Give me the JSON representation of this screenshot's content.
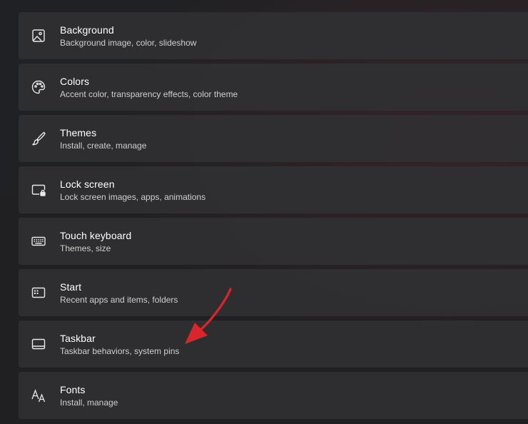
{
  "settings": {
    "items": [
      {
        "icon": "image-icon",
        "title": "Background",
        "subtitle": "Background image, color, slideshow"
      },
      {
        "icon": "palette-icon",
        "title": "Colors",
        "subtitle": "Accent color, transparency effects, color theme"
      },
      {
        "icon": "brush-icon",
        "title": "Themes",
        "subtitle": "Install, create, manage"
      },
      {
        "icon": "lock-screen-icon",
        "title": "Lock screen",
        "subtitle": "Lock screen images, apps, animations"
      },
      {
        "icon": "keyboard-icon",
        "title": "Touch keyboard",
        "subtitle": "Themes, size"
      },
      {
        "icon": "start-menu-icon",
        "title": "Start",
        "subtitle": "Recent apps and items, folders"
      },
      {
        "icon": "taskbar-icon",
        "title": "Taskbar",
        "subtitle": "Taskbar behaviors, system pins"
      },
      {
        "icon": "fonts-icon",
        "title": "Fonts",
        "subtitle": "Install, manage"
      }
    ]
  },
  "colors": {
    "annotation_arrow": "#d9252b",
    "card_background": "#303032",
    "text_primary": "#ffffff",
    "text_secondary": "#cfcfcf"
  }
}
